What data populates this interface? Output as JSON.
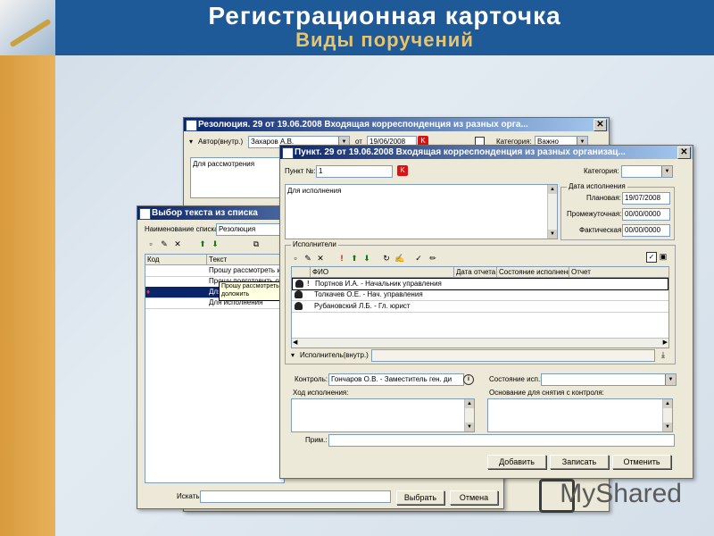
{
  "slide": {
    "title": "Регистрационная карточка",
    "subtitle": "Виды поручений",
    "watermark": "MyShared"
  },
  "resolution_window": {
    "title": "Резолюция. 29 от 19.06.2008 Входящая корреспонденция из разных орга...",
    "author_label": "Автор(внутр.)",
    "author_value": "Захаров А.В.",
    "date_label": "от",
    "date_value": "19/06/2008",
    "category_label": "Категория:",
    "category_value": "Важно",
    "text_value": "Для рассмотрения"
  },
  "select_window": {
    "title": "Выбор текста из списка",
    "list_name_label": "Наименование списка:",
    "list_name_value": "Резолюция",
    "columns": [
      "Код",
      "Текст"
    ],
    "rows": [
      {
        "code": "",
        "text": "Прошу рассмотреть и д"
      },
      {
        "code": "",
        "text": "Прошу подготовить отв"
      },
      {
        "code": "",
        "text": "Для"
      },
      {
        "code": "",
        "text": "Для исполнения"
      }
    ],
    "tooltip_line1": "Прошу рассмотреть и",
    "tooltip_line2": "доложить",
    "search_label": "Искать:",
    "select_button": "Выбрать",
    "cancel_button": "Отмена"
  },
  "point_window": {
    "title": "Пункт. 29 от 19.06.2008 Входящая корреспонденция из разных организац...",
    "point_label": "Пункт №:",
    "point_value": "1",
    "category_label": "Категория:",
    "text_value": "Для исполнения",
    "dates_group": "Дата исполнения",
    "planned_label": "Плановая:",
    "planned_value": "19/07/2008",
    "interim_label": "Промежуточная:",
    "interim_value": "00/00/0000",
    "actual_label": "Фактическая:",
    "actual_value": "00/00/0000",
    "executors_group": "Исполнители",
    "columns": [
      "ФИО",
      "Дата отчета",
      "Состояние исполнения",
      "Отчет"
    ],
    "executors": [
      {
        "mark": "!",
        "name": "Портнов И.А. - Начальник управления"
      },
      {
        "mark": "",
        "name": "Толкачев О.Е. - Нач. управления"
      },
      {
        "mark": "",
        "name": "Рубановский Л.Б. - Гл. юрист"
      }
    ],
    "internal_executor_label": "Исполнитель(внутр.)",
    "control_label": "Контроль:",
    "control_value": "Гончаров О.В. - Заместитель ген. ди",
    "status_label": "Состояние исп.:",
    "progress_label": "Ход исполнения:",
    "basis_label": "Основание для снятия с контроля:",
    "note_label": "Прим.:",
    "add_button": "Добавить",
    "save_button": "Записать",
    "cancel_button": "Отменить"
  }
}
